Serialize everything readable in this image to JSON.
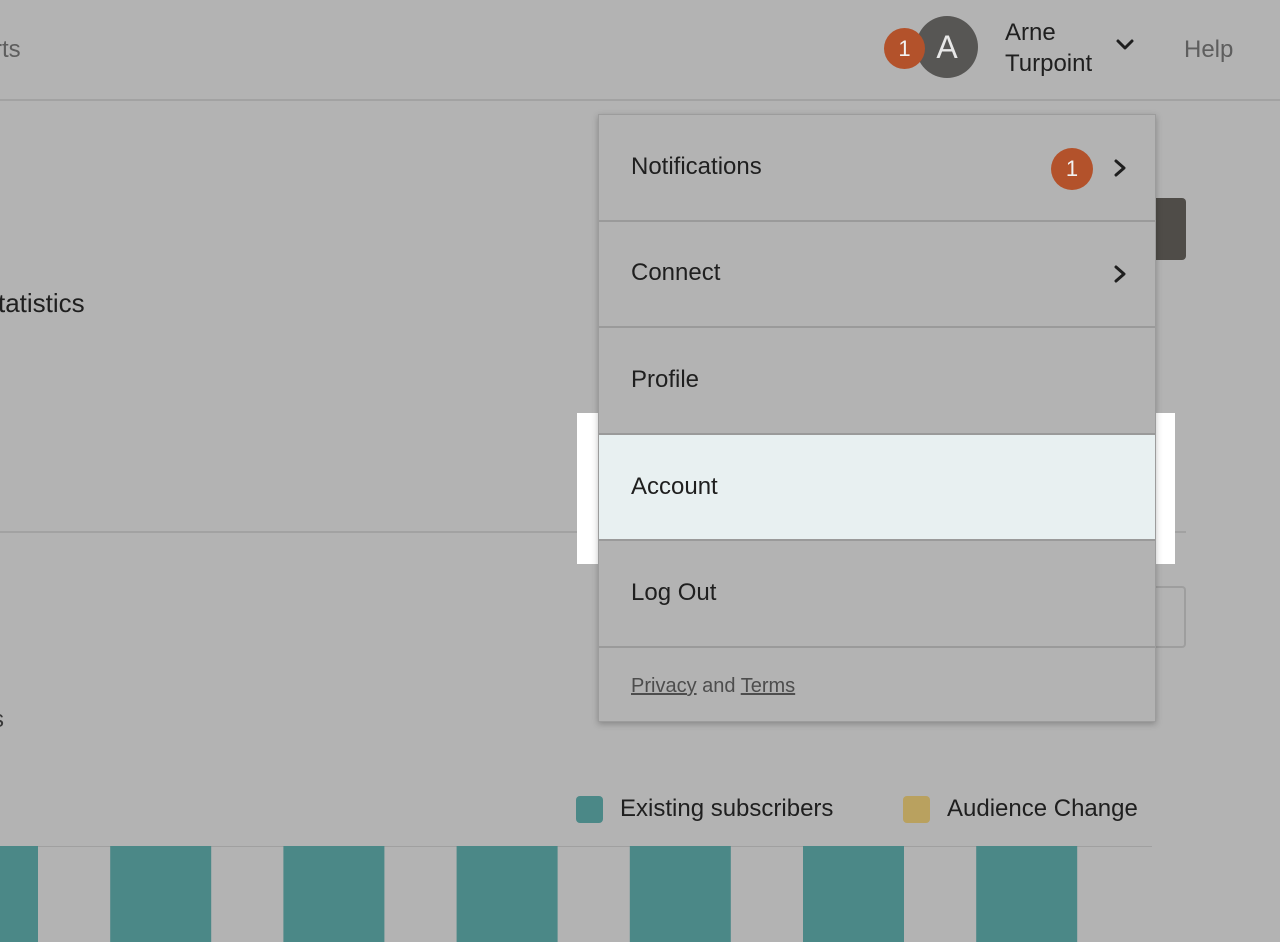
{
  "header": {
    "nav_fragment": "rts",
    "notification_count": "1",
    "avatar_initial": "A",
    "user_first_name": "Arne",
    "user_last_name": "Turpoint",
    "help_label": "Help"
  },
  "page": {
    "section_title_fragment": "tatistics",
    "stray_text": "s"
  },
  "chart_data": {
    "type": "bar",
    "legend": [
      {
        "name": "Existing subscribers",
        "color": "#4b8887"
      },
      {
        "name": "Audience Change",
        "color": "#b9a15f"
      }
    ],
    "series": [
      {
        "name": "Existing subscribers",
        "values": [
          1,
          1,
          1,
          1,
          1,
          1,
          1
        ]
      }
    ],
    "bar_color": "#4b8887",
    "note_visible": "bars are cropped at bottom edge"
  },
  "dropdown": {
    "items": [
      {
        "label": "Notifications",
        "badge": "1",
        "has_chevron": true
      },
      {
        "label": "Connect",
        "has_chevron": true
      },
      {
        "label": "Profile",
        "has_chevron": false
      },
      {
        "label": "Account",
        "has_chevron": false,
        "highlighted": true
      },
      {
        "label": "Log Out",
        "has_chevron": false
      }
    ],
    "footer": {
      "privacy": "Privacy",
      "and": "and",
      "terms": "Terms"
    }
  },
  "colors": {
    "background": "#b3b3b3",
    "badge": "#b3522b",
    "avatar": "#575654",
    "highlight": "#e8f0f1",
    "teal": "#4b8887",
    "gold": "#b9a15f"
  }
}
